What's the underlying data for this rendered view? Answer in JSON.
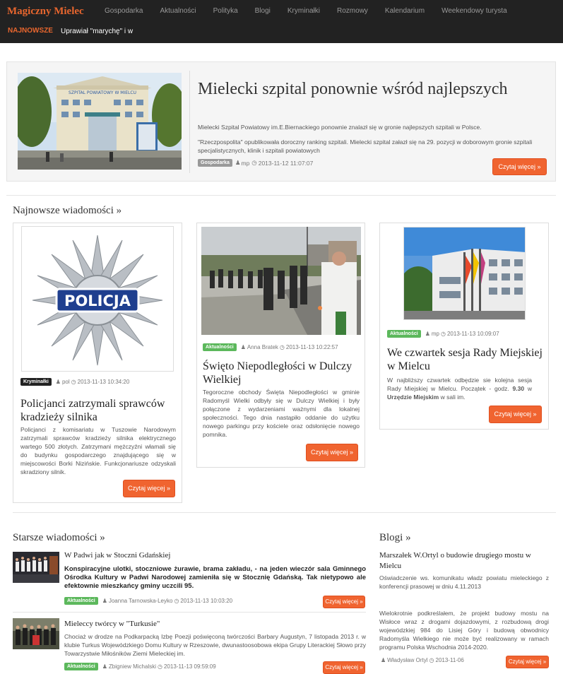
{
  "brand": "Magiczny Mielec",
  "nav": [
    "Gospodarka",
    "Aktualności",
    "Polityka",
    "Blogi",
    "Kryminałki",
    "Rozmowy",
    "Kalendarium",
    "Weekendowy turysta"
  ],
  "ticker": {
    "label": "NAJNOWSZE",
    "text": "Uprawiał \"marychę\" i w"
  },
  "hero": {
    "title": "Mielecki szpital ponownie wśród najlepszych",
    "p1": "Mielecki Szpital Powiatowy im.E.Biernackiego ponownie znalazł się w gronie najlepszych szpitali w Polsce.",
    "p2": "\"Rzeczpospolita\" opublikowała doroczny ranking szpitali. Mielecki szpital załazł się na 29. pozycji w doborowym gronie szpitali specjalistycznych, klinik i szpitali powiatowych",
    "category": "Gospodarka",
    "author": "mp",
    "date": "2013-11-12 11:07:07",
    "button": "Czytaj więcej »",
    "sign_text": "SZPITAL POWIATOWY W MIELCU"
  },
  "latest": {
    "title": "Najnowsze wiadomości »",
    "cards": [
      {
        "category": "Kryminałki",
        "author": "pol",
        "date": "2013-11-13 10:34:20",
        "title": "Policjanci zatrzymali sprawców kradzieży silnika",
        "text": "Policjanci z komisariatu w Tuszowie Narodowym zatrzymali sprawców kradzieży silnika elektrycznego wartego 500 złotych. Zatrzymani mężczyźni włamali się do budynku gospodarczego znajdującego się w miejscowości Borki Nizińskie. Funkcjonariusze odzyskali skradziony silnik.",
        "button": "Czytaj więcej »",
        "badge_text": "POLICJA"
      },
      {
        "category": "Aktualności",
        "author": "Anna Bratek",
        "date": "2013-11-13 10:22:57",
        "title": "Święto Niepodległości w Dulczy Wielkiej",
        "text": "Tegoroczne obchody Święta Niepodległości w gminie Radomyśl Wielki odbyły się w Dulczy Wielkiej i były połączone z wydarzeniami ważnymi dla lokalnej społeczności. Tego dnia nastąpiło oddanie do użytku nowego parkingu przy kościele oraz odsłonięcie nowego pomnika.",
        "button": "Czytaj więcej »"
      },
      {
        "category": "Aktualności",
        "author": "mp",
        "date": "2013-11-13 10:09:07",
        "title": "We czwartek sesja Rady Miejskiej w Mielcu",
        "text_pre": "W najbliższy czwartek odbędzie sie kolejna sesja Rady Miejskiej w Mielcu. Początek - godz. ",
        "text_bold1": "9.30",
        "text_mid": " w ",
        "text_bold2": "Urzędzie Miejskim",
        "text_post": " w sali im.",
        "button": "Czytaj więcej »"
      }
    ]
  },
  "older": {
    "title": "Starsze wiadomości »",
    "items": [
      {
        "title": "W Padwi jak w Stoczni Gdańskiej",
        "lead": "Konspiracyjne ulotki, stoczniowe żurawie, brama zakładu, - na jeden wieczór sala Gminnego Ośrodka Kultury w Padwi Narodowej zamieniła się w Stocznię Gdańską. Tak nietypowo ale efektownie mieszkańcy gminy uczcili 95.",
        "category": "Aktualności",
        "author": "Joanna Tarnowska-Leyko",
        "date": "2013-11-13 10:03:20",
        "button": "Czytaj więcej »"
      },
      {
        "title": "Mieleccy twórcy w \"Turkusie\"",
        "text": "Chociaż w drodze na Podkarpacką Izbę Poezji poświęconą twórczości Barbary Augustyn, 7 listopada 2013 r. w klubie Turkus Wojewódzkiego Domu Kultury w Rzeszowie, dwunastoosobowa ekipa Grupy Literackiej Słowo przy Towarzystwie Miłośników Ziemi Mieleckiej im.",
        "category": "Aktualności",
        "author": "Zbigniew Michalski",
        "date": "2013-11-13 09:59:09",
        "button": "Czytaj więcej »"
      }
    ]
  },
  "blogs": {
    "title": "Blogi »",
    "items": [
      {
        "title": "Marszałek W.Ortyl o budowie drugiego mostu w Mielcu",
        "text": "Oświadczenie ws. komunikatu władz powiatu mieleckiego z konferencji prasowej w dniu 4.11.2013",
        "author": "",
        "date": "",
        "button": ""
      },
      {
        "title": "",
        "text": "Wielokrotnie podkreślałem, że projekt budowy mostu na Wisłoce wraz z drogami dojazdowymi, z rozbudową drogi wojewódzkiej 984 do Lisiej Góry i budową obwodnicy Radomyśla Wielkiego nie może być realizowany w ramach programu Polska Wschodnia 2014-2020.",
        "author": "Władysław Ortyl",
        "date": "2013-11-06",
        "button": "Czytaj więcej »"
      }
    ]
  }
}
